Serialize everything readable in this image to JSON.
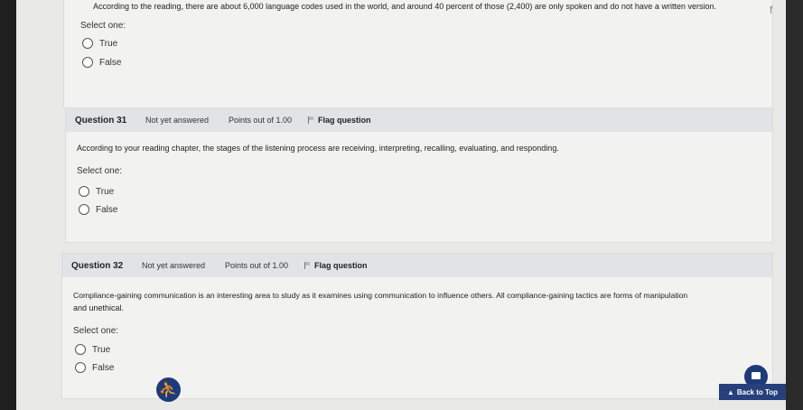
{
  "q30": {
    "text": "According to the reading, there are about 6,000 language codes used in the world, and around 40 percent of those (2,400) are only spoken and do not have a written version.",
    "select_label": "Select one:",
    "options": [
      "True",
      "False"
    ]
  },
  "q31": {
    "number": "Question 31",
    "state": "Not yet answered",
    "points": "Points out of 1.00",
    "flag": "Flag question",
    "text": "According to your reading chapter, the stages of the listening process are receiving, interpreting, recalling, evaluating, and responding.",
    "select_label": "Select one:",
    "options": [
      "True",
      "False"
    ]
  },
  "q32": {
    "number": "Question 32",
    "state": "Not yet answered",
    "points": "Points out of 1.00",
    "flag": "Flag question",
    "text_line1": "Compliance-gaining communication is an interesting area to study as it examines using communication to influence others. All compliance-gaining tactics are forms of manipulation",
    "text_line2": "and unethical.",
    "select_label": "Select one:",
    "options": [
      "True",
      "False"
    ]
  },
  "footer": {
    "back_to_top": "Back to Top"
  },
  "corner_glyph": "f"
}
